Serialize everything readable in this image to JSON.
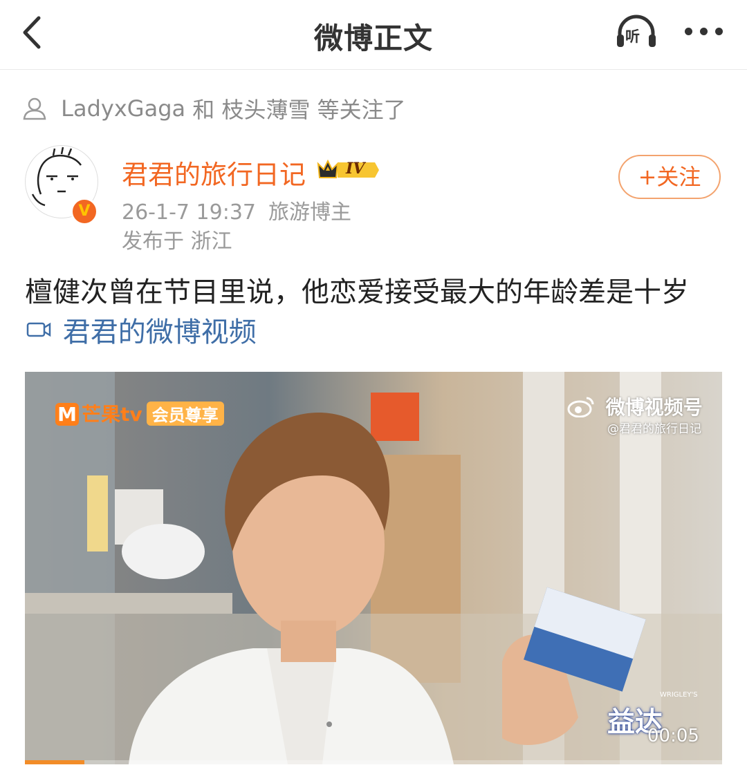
{
  "header": {
    "title": "微博正文",
    "listen_label": "听"
  },
  "follow_notice": {
    "user1": "LadyxGaga",
    "and": "和",
    "user2": "枝头薄雪",
    "suffix": "等关注了"
  },
  "author": {
    "name": "君君的旅行日记",
    "level": "IV",
    "verified_badge": "V",
    "timestamp": "26-1-7 19:37",
    "role": "旅游博主",
    "location": "发布于 浙江",
    "follow_label": "+关注"
  },
  "post": {
    "text": "檀健次曾在节目里说，他恋爱接受最大的年龄差是十岁",
    "video_link": "君君的微博视频"
  },
  "video": {
    "channel_brand": "芒果tv",
    "channel_tag": "会员尊享",
    "watermark": "微博视频号",
    "watermark_handle": "@君君的旅行日记",
    "ad_brand": "益达",
    "ad_maker": "WRIGLEY'S",
    "timecode": "00:05",
    "progress": 0.085
  },
  "colors": {
    "accent_orange": "#f26722",
    "link_blue": "#3f6ea7",
    "meta_gray": "#9a9a9a"
  },
  "icons": [
    "back-arrow-icon",
    "headphones-icon",
    "more-dots-icon",
    "person-icon",
    "video-camera-icon",
    "weibo-eye-icon"
  ]
}
